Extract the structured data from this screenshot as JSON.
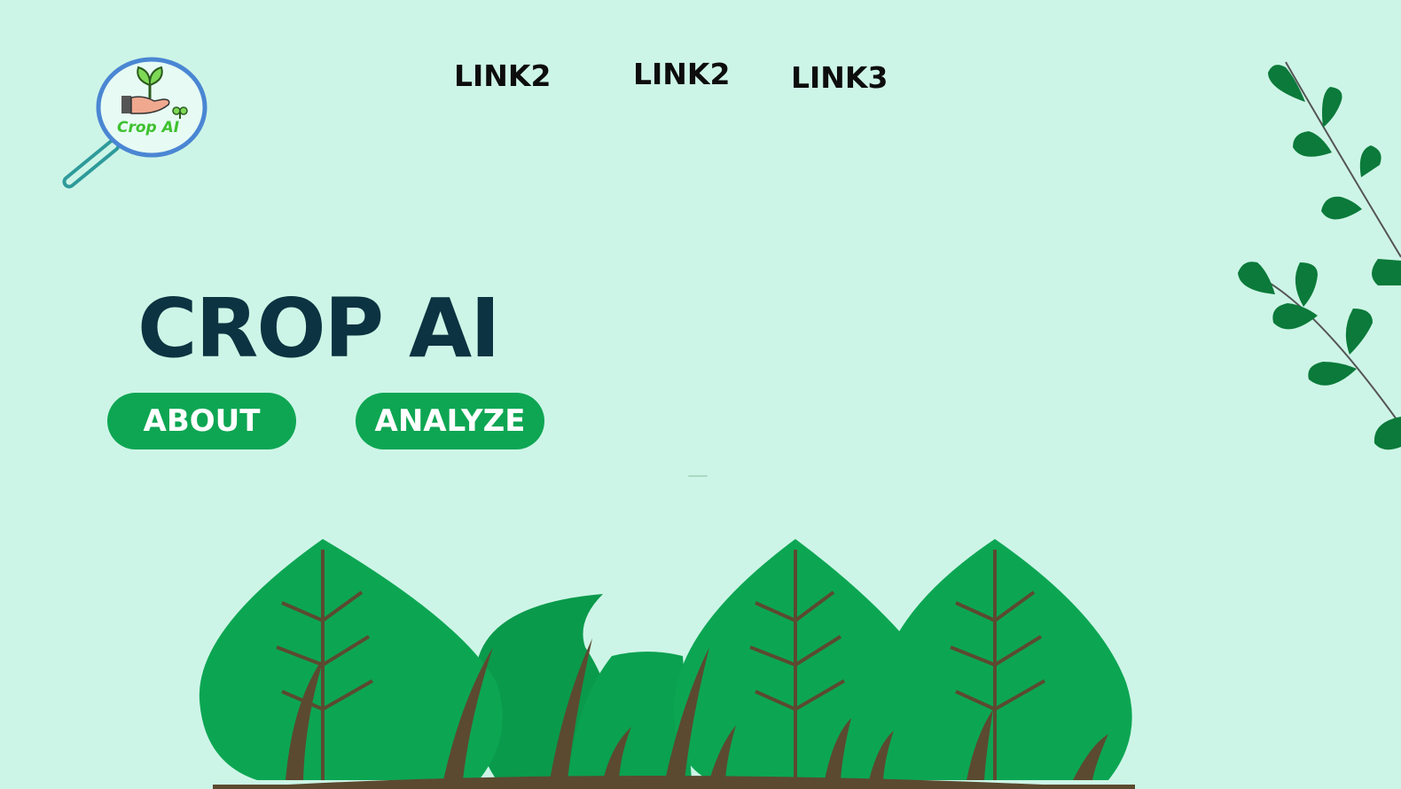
{
  "brand": {
    "logo_text": "Crop AI",
    "icon": "magnifier-plant-hand-logo"
  },
  "nav": {
    "links": [
      {
        "label": "LINK2"
      },
      {
        "label": "LINK2"
      },
      {
        "label": "LINK3"
      }
    ]
  },
  "hero": {
    "title": "CROP AI",
    "buttons": {
      "about": "ABOUT",
      "analyze": "ANALYZE"
    }
  },
  "colors": {
    "background": "#cdf5e7",
    "title": "#0b3341",
    "button": "#0ea653",
    "leaf": "#0b7a3a",
    "bush": "#0ca653",
    "trunk": "#5b4a2f"
  }
}
